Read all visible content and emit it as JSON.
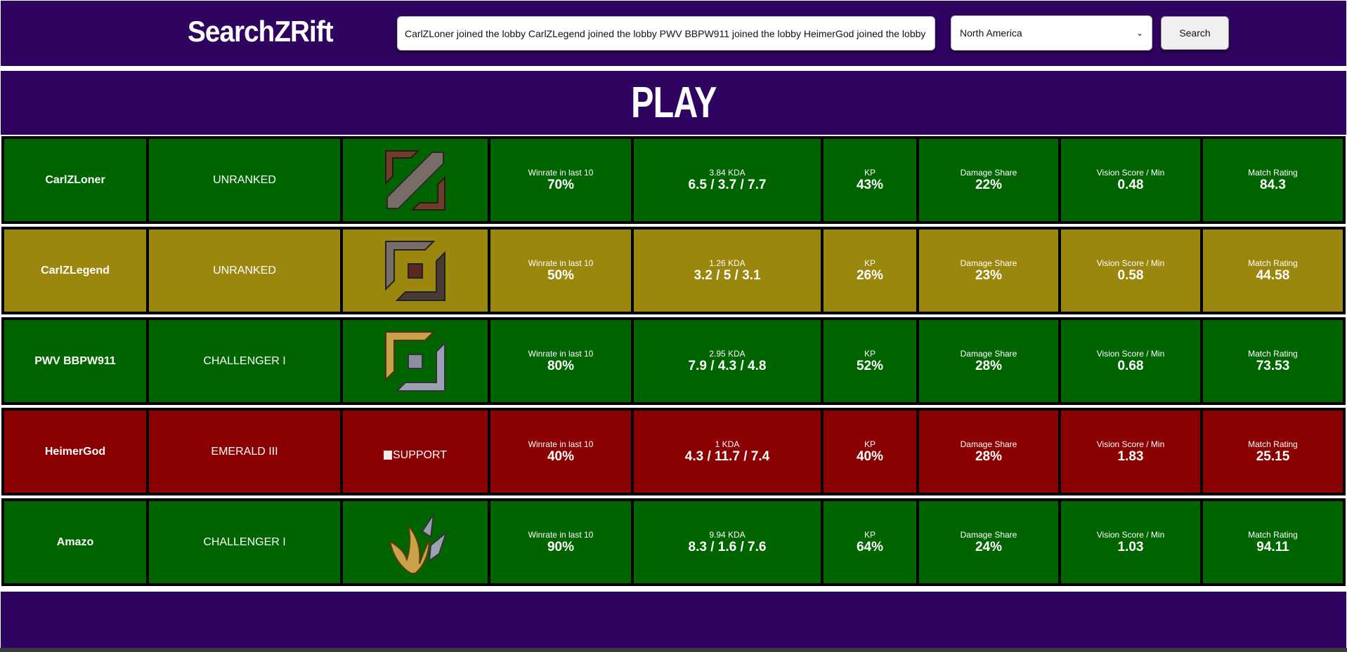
{
  "app": {
    "title": "SearchZRift"
  },
  "search": {
    "value": "CarlZLoner joined the lobby CarlZLegend joined the lobby PWV BBPW911 joined the lobby HeimerGod joined the lobby Amazo joined the lobby",
    "region_selected": "North America",
    "button_label": "Search"
  },
  "banner": {
    "title": "PLAY"
  },
  "colors": {
    "header_bg": "#2f0460",
    "good": "#006400",
    "average": "#9c870e",
    "bad": "#8b0000"
  },
  "labels": {
    "winrate": "Winrate in last 10",
    "kp": "KP",
    "damage": "Damage Share",
    "vision": "Vision Score / Min",
    "rating": "Match Rating"
  },
  "players": [
    {
      "name": "CarlZLoner",
      "rank": "UNRANKED",
      "role_icon": "jungle-role-icon",
      "winrate": "70%",
      "kda_ratio": "3.84 KDA",
      "kda": "6.5 / 3.7 / 7.7",
      "kp": "43%",
      "damage": "22%",
      "vision": "0.48",
      "rating": "84.3",
      "status": "good",
      "color": "#006400"
    },
    {
      "name": "CarlZLegend",
      "rank": "UNRANKED",
      "role_icon": "top-role-icon",
      "winrate": "50%",
      "kda_ratio": "1.26 KDA",
      "kda": "3.2 / 5 / 3.1",
      "kp": "26%",
      "damage": "23%",
      "vision": "0.58",
      "rating": "44.58",
      "status": "average",
      "color": "#9c870e"
    },
    {
      "name": "PWV BBPW911",
      "rank": "CHALLENGER I",
      "role_icon": "bottom-role-icon",
      "winrate": "80%",
      "kda_ratio": "2.95 KDA",
      "kda": "7.9 / 4.3 / 4.8",
      "kp": "52%",
      "damage": "28%",
      "vision": "0.68",
      "rating": "73.53",
      "status": "good",
      "color": "#006400"
    },
    {
      "name": "HeimerGod",
      "rank": "EMERALD III",
      "role_icon": "support-role-icon",
      "role_alt": "SUPPORT",
      "winrate": "40%",
      "kda_ratio": "1 KDA",
      "kda": "4.3 / 11.7 / 7.4",
      "kp": "40%",
      "damage": "28%",
      "vision": "1.83",
      "rating": "25.15",
      "status": "bad",
      "color": "#8b0000"
    },
    {
      "name": "Amazo",
      "rank": "CHALLENGER I",
      "role_icon": "middle-role-icon",
      "winrate": "90%",
      "kda_ratio": "9.94 KDA",
      "kda": "8.3 / 1.6 / 7.6",
      "kp": "64%",
      "damage": "24%",
      "vision": "1.03",
      "rating": "94.11",
      "status": "good",
      "color": "#006400"
    }
  ]
}
